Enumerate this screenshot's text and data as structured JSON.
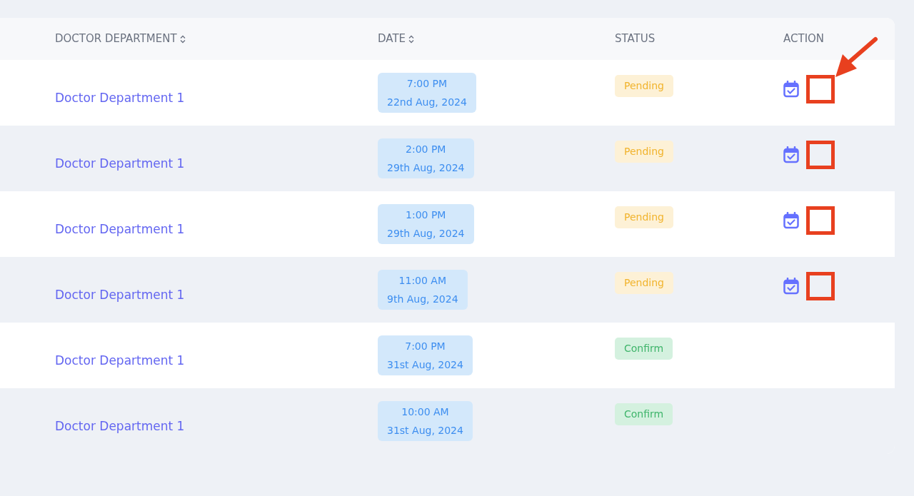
{
  "table": {
    "columns": [
      {
        "label": "DOCTOR DEPARTMENT",
        "sortable": true
      },
      {
        "label": "DATE",
        "sortable": true
      },
      {
        "label": "STATUS",
        "sortable": false
      },
      {
        "label": "ACTION",
        "sortable": false
      }
    ],
    "rows": [
      {
        "department": "Doctor Department 1",
        "time": "7:00 PM",
        "date": "22nd Aug, 2024",
        "status": "Pending",
        "kind": "pending",
        "highlighted": true
      },
      {
        "department": "Doctor Department 1",
        "time": "2:00 PM",
        "date": "29th Aug, 2024",
        "status": "Pending",
        "kind": "pending",
        "highlighted": true
      },
      {
        "department": "Doctor Department 1",
        "time": "1:00 PM",
        "date": "29th Aug, 2024",
        "status": "Pending",
        "kind": "pending",
        "highlighted": true
      },
      {
        "department": "Doctor Department 1",
        "time": "11:00 AM",
        "date": "9th Aug, 2024",
        "status": "Pending",
        "kind": "pending",
        "highlighted": true
      },
      {
        "department": "Doctor Department 1",
        "time": "7:00 PM",
        "date": "31st Aug, 2024",
        "status": "Confirm",
        "kind": "confirm",
        "highlighted": false
      },
      {
        "department": "Doctor Department 1",
        "time": "10:00 AM",
        "date": "31st Aug, 2024",
        "status": "Confirm",
        "kind": "confirm",
        "highlighted": false
      }
    ]
  },
  "annotation_arrow": true
}
